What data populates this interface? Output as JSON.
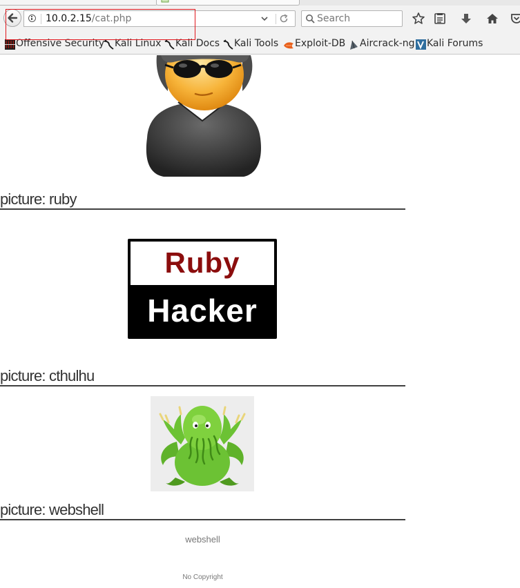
{
  "browser": {
    "url_host": "10.0.2.15",
    "url_path": "/cat.php",
    "search_placeholder": "Search",
    "bookmarks": [
      {
        "label": "Offensive Security"
      },
      {
        "label": "Kali Linux"
      },
      {
        "label": "Kali Docs"
      },
      {
        "label": "Kali Tools"
      },
      {
        "label": "Exploit-DB"
      },
      {
        "label": "Aircrack-ng"
      },
      {
        "label": "Kali Forums"
      }
    ],
    "highlight_color": "#e0151b"
  },
  "page": {
    "pictures": [
      {
        "heading": "picture: ruby",
        "image_text_top": "Ruby",
        "image_text_bottom": "Hacker"
      },
      {
        "heading": "picture: cthulhu"
      },
      {
        "heading": "picture: webshell",
        "caption": "webshell"
      }
    ],
    "footer": "No Copyright"
  },
  "icons": [
    "back-arrow-icon",
    "info-icon",
    "dropdown-arrow-icon",
    "reload-icon",
    "search-icon",
    "bookmark-star-icon",
    "reading-list-icon",
    "download-icon",
    "home-icon",
    "pocket-icon"
  ],
  "colors": {
    "heading_rule": "#3f3f3f",
    "ruby_red": "#8b0d0d"
  }
}
